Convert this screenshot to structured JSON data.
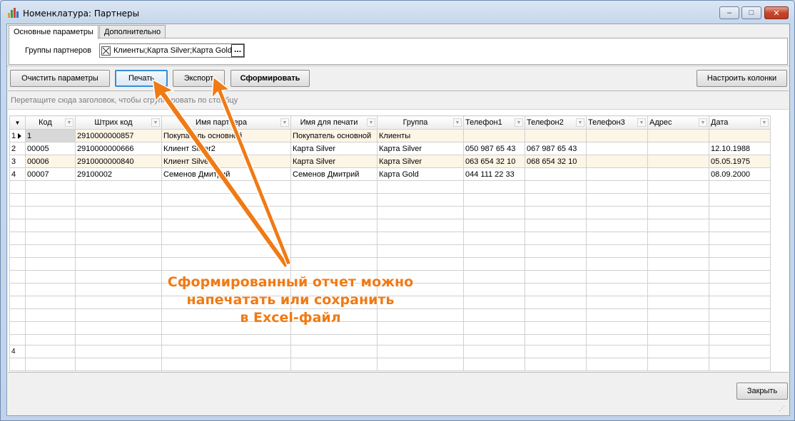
{
  "window": {
    "title": "Номенклатура: Партнеры",
    "controls": {
      "minimize": "–",
      "maximize": "□",
      "close": "✕"
    }
  },
  "tabs": [
    {
      "label": "Основные параметры",
      "active": true
    },
    {
      "label": "Дополнительно",
      "active": false
    }
  ],
  "filter": {
    "label": "Группы партнеров",
    "value": "Клиенты;Карта Silver;Карта Gold",
    "browse_label": "..."
  },
  "toolbar": {
    "clear_label": "Очистить параметры",
    "print_label": "Печать",
    "export_label": "Экспорт",
    "build_label": "Сформировать",
    "columns_label": "Настроить колонки"
  },
  "grid": {
    "group_hint": "Перетащите сюда заголовок, чтобы сгруппировать по столбцу",
    "columns": [
      "Код",
      "Штрих код",
      "Имя партнера",
      "Имя для печати",
      "Группа",
      "Телефон1",
      "Телефон2",
      "Телефон3",
      "Адрес",
      "Дата"
    ],
    "rows": [
      {
        "num": "1",
        "cells": [
          "1",
          "2910000000857",
          "Покупатель основной",
          "Покупатель основной",
          "Клиенты",
          "",
          "",
          "",
          "",
          ""
        ]
      },
      {
        "num": "2",
        "cells": [
          "00005",
          "2910000000666",
          "Клиент Silver2",
          "Карта Silver",
          "Карта Silver",
          "050 987 65 43",
          "067 987 65 43",
          "",
          "",
          "12.10.1988"
        ]
      },
      {
        "num": "3",
        "cells": [
          "00006",
          "2910000000840",
          "Клиент Silver1",
          "Карта Silver",
          "Карта Silver",
          "063 654 32 10",
          "068 654 32 10",
          "",
          "",
          "05.05.1975"
        ]
      },
      {
        "num": "4",
        "cells": [
          "00007",
          "29100002",
          "Семенов Дмитрий",
          "Семенов Дмитрий",
          "Карта Gold",
          "044 111 22 33",
          "",
          "",
          "",
          "08.09.2000"
        ]
      }
    ],
    "summary_count": "4"
  },
  "footer": {
    "close_label": "Закрыть"
  },
  "annotation": {
    "lines": [
      "Сформированный отчет можно",
      "напечатать или сохранить",
      "в Excel-файл"
    ],
    "color": "#f07a14"
  },
  "colors": {
    "odd_row": "#fdf5e6",
    "focus": "#3a8bd6"
  }
}
